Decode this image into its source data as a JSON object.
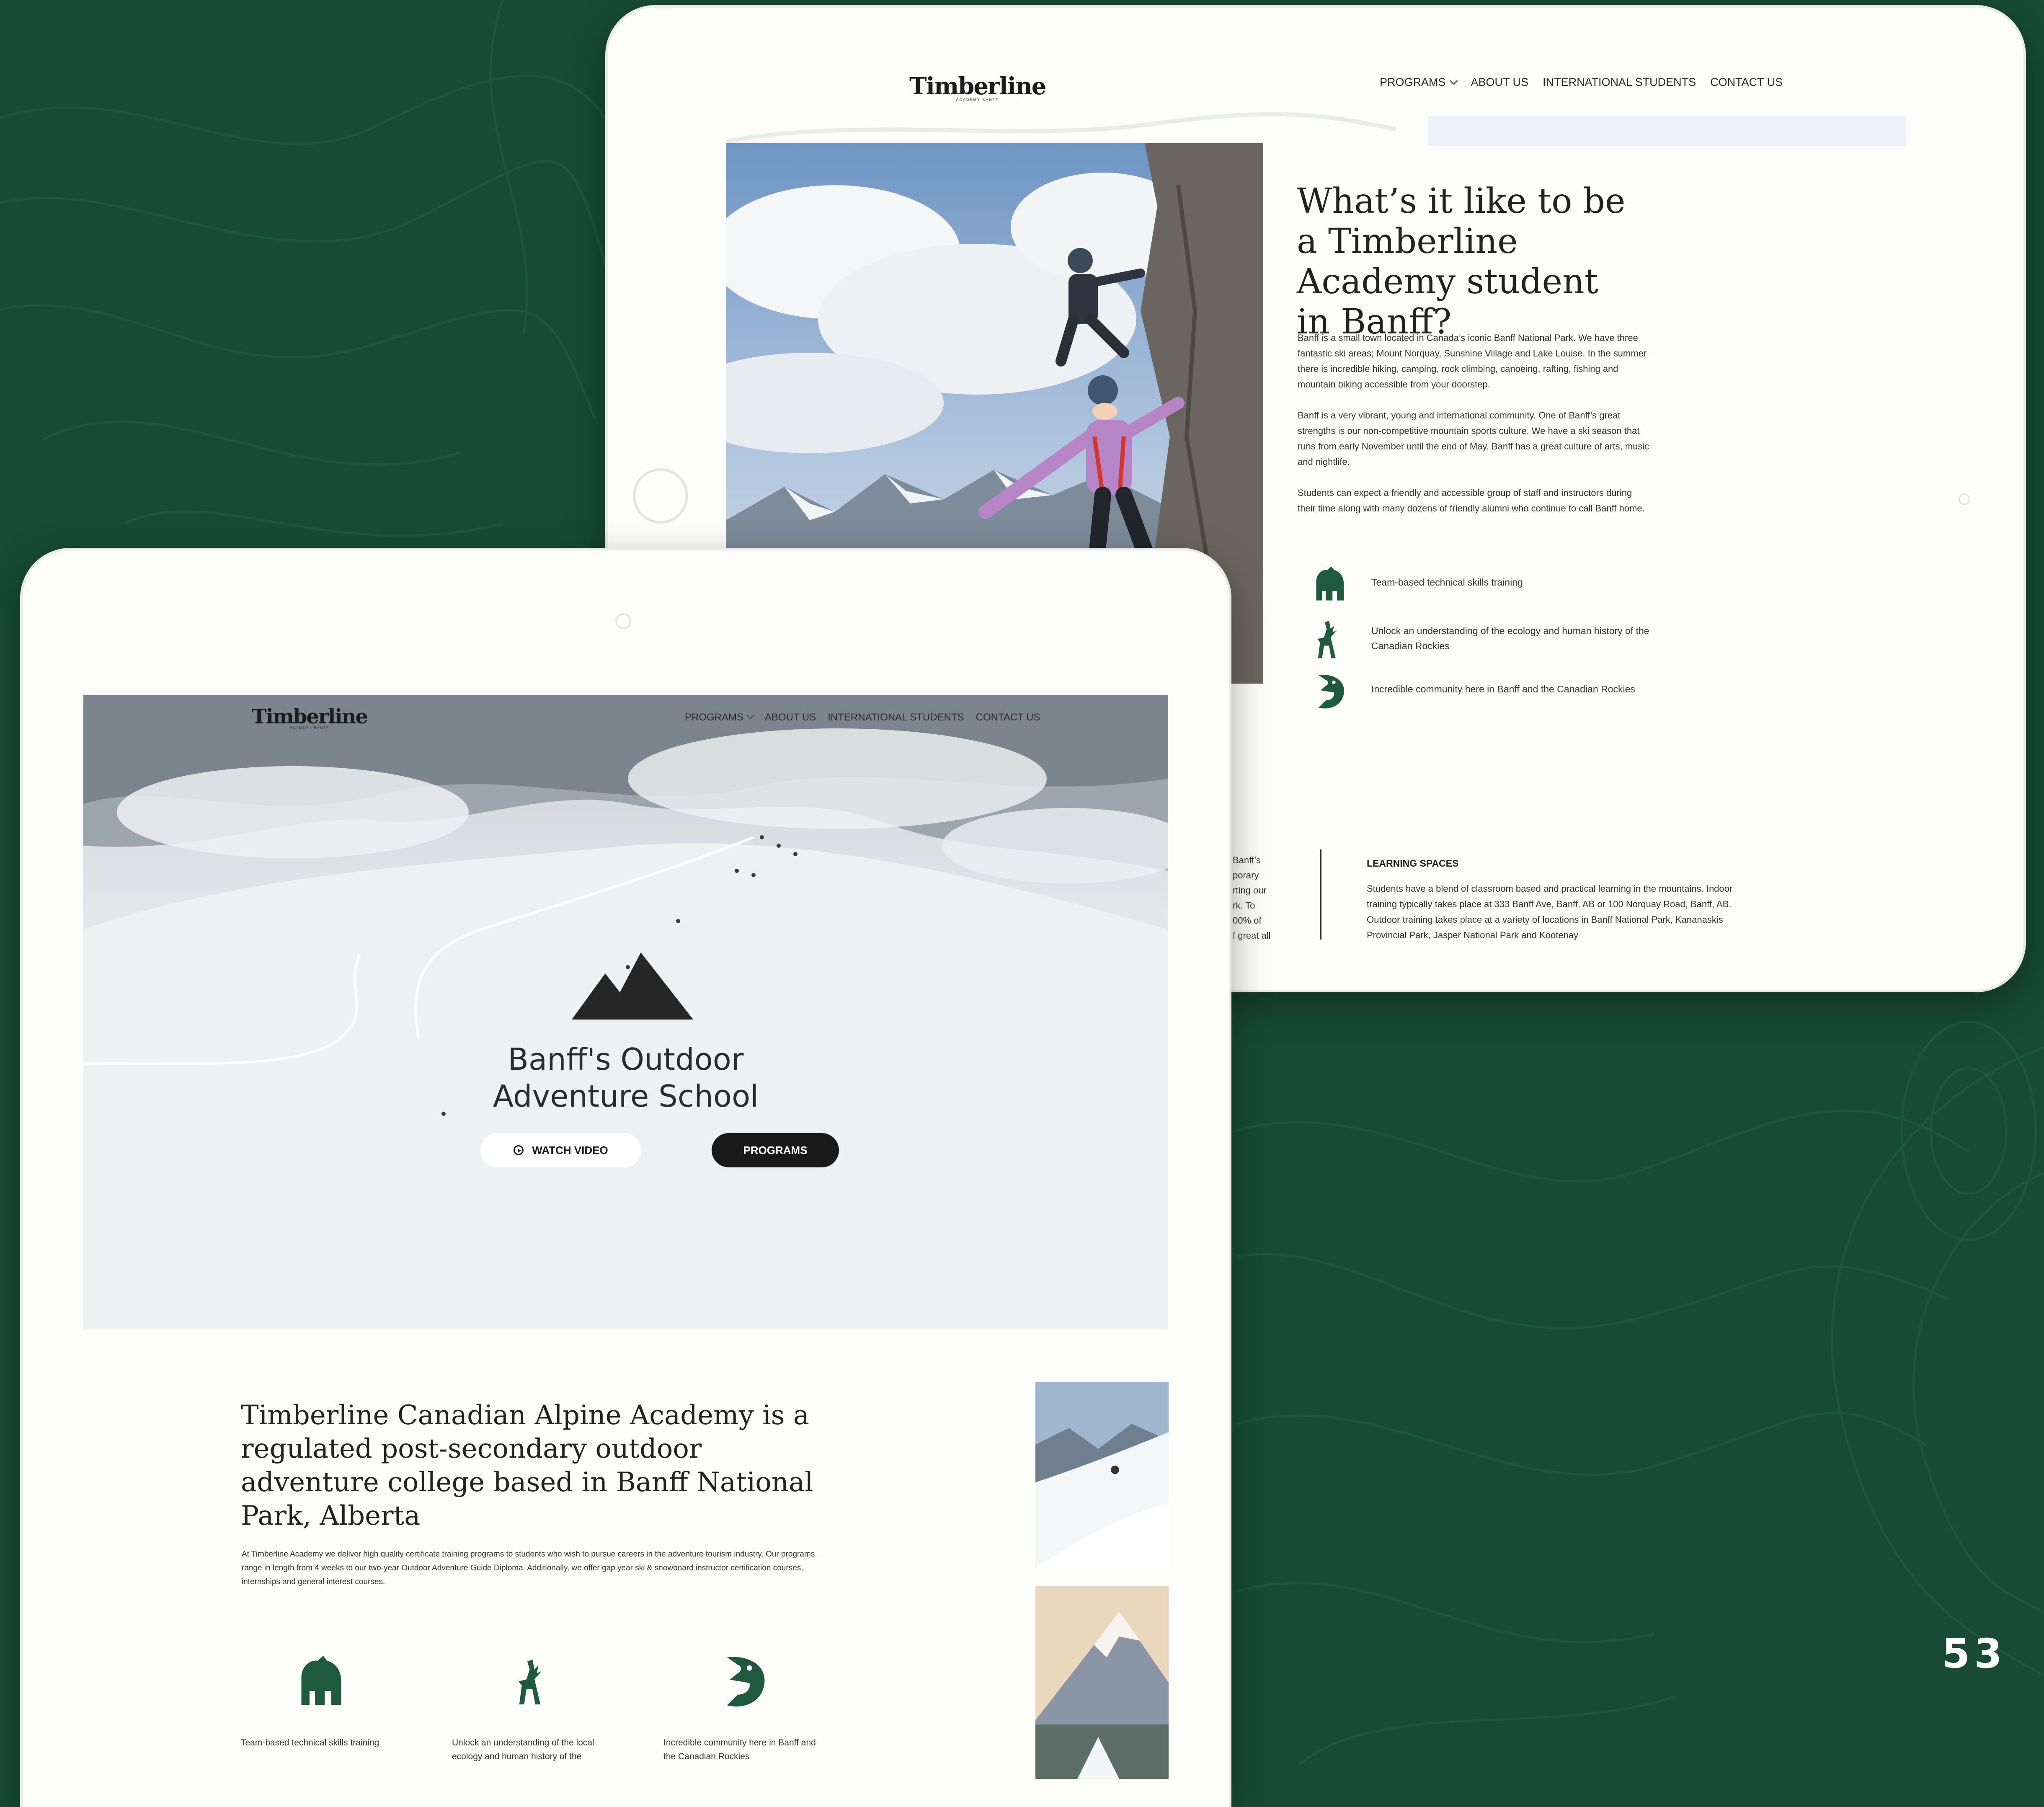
{
  "colors": {
    "background": "#184a37",
    "icon_green": "#1f5a3e",
    "button_dark": "#1a1a1a"
  },
  "page_number": "53",
  "back_site": {
    "logo": "Timberline",
    "logo_tagline": "ACADEMY BANFF",
    "nav": {
      "programs": "PROGRAMS",
      "about": "ABOUT US",
      "international": "INTERNATIONAL STUDENTS",
      "contact": "CONTACT US"
    },
    "heading": "What’s it like to be a Timberline Academy student in Banff?",
    "paragraphs": [
      "Banff is a small town located in Canada’s iconic Banff National Park. We have three fantastic ski areas; Mount Norquay, Sunshine Village and Lake Louise. In the summer there is incredible hiking, camping, rock climbing, canoeing, rafting, fishing and mountain biking accessible from your doorstep.",
      "Banff is a very vibrant, young and international community. One of Banff’s great strengths is our non-competitive mountain sports culture. We have a ski season that runs from early November until the end of May. Banff has a great culture of arts, music and nightlife.",
      "Students can expect a friendly and accessible group of staff and instructors during their time along with many dozens of friendly alumni who continue to call Banff home."
    ],
    "features": [
      {
        "icon": "bear-icon",
        "text": "Team-based technical skills training"
      },
      {
        "icon": "elk-icon",
        "text": "Unlock an understanding of the ecology and human history of the Canadian Rockies"
      },
      {
        "icon": "fish-icon",
        "text": "Incredible community here in Banff and the Canadian Rockies"
      }
    ],
    "cut_column_fragment": "Banff’s\nporary\nrting our\nrk. To\n00% of\nf great all",
    "learning_spaces": {
      "title": "LEARNING SPACES",
      "text": "Students have a blend of classroom based and practical learning in the mountains. Indoor training typically takes place at 333 Banff Ave, Banff, AB or 100 Norquay Road, Banff, AB. Outdoor training takes place at a variety of locations in Banff National Park, Kananaskis Provincial Park, Jasper National Park and Kootenay"
    }
  },
  "front_site": {
    "logo": "Timberline",
    "logo_tagline": "ACADEMY BANFF",
    "nav": {
      "programs": "PROGRAMS",
      "about": "ABOUT US",
      "international": "INTERNATIONAL STUDENTS",
      "contact": "CONTACT US"
    },
    "hero": {
      "logo_icon": "mountain-logo-icon",
      "title": "Banff's Outdoor Adventure School",
      "watch_button": "WATCH VIDEO",
      "programs_button": "PROGRAMS"
    },
    "intro_heading": "Timberline Canadian Alpine Academy is a regulated post-secondary outdoor adventure college based in Banff National Park, Alberta",
    "intro_text": "At Timberline Academy we deliver high quality certificate training programs to students who wish to pursue careers in the adventure tourism industry. Our programs range in length from 4 weeks to our two-year Outdoor Adventure Guide Diploma. Additionally, we offer gap year ski & snowboard instructor certification courses, internships and general interest courses.",
    "features": [
      {
        "icon": "bear-icon",
        "text": "Team-based technical skills training"
      },
      {
        "icon": "elk-icon",
        "text": "Unlock an understanding of the local ecology and human history of the"
      },
      {
        "icon": "fish-icon",
        "text": "Incredible community here in Banff and the Canadian Rockies"
      }
    ]
  }
}
